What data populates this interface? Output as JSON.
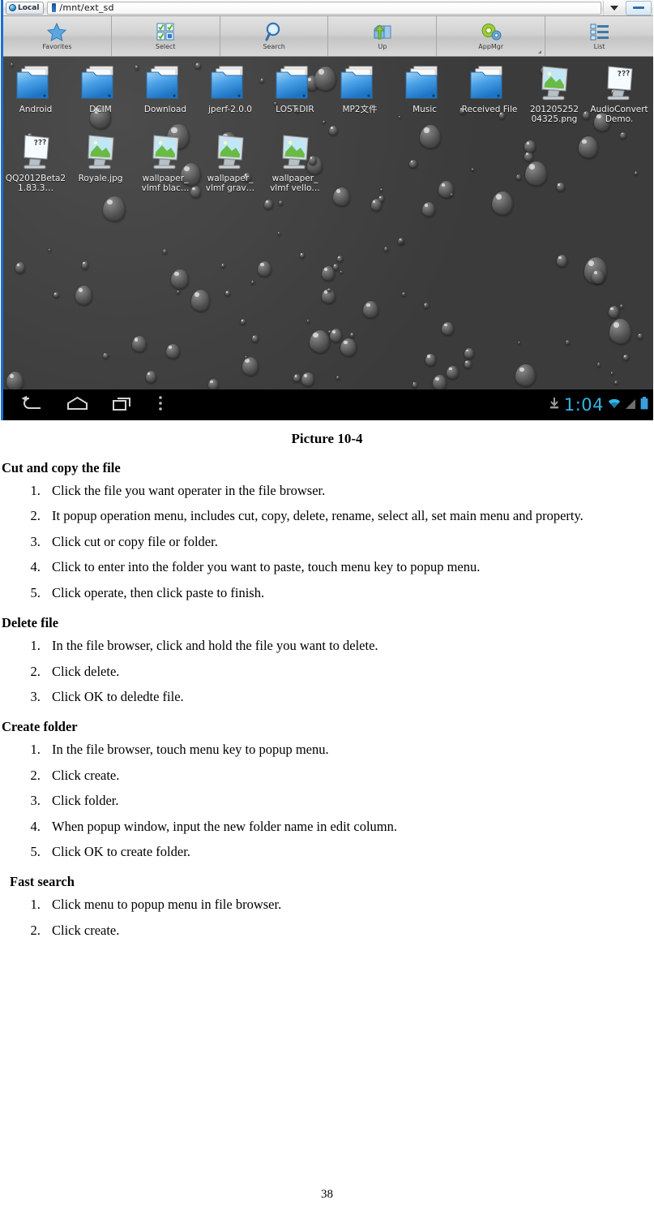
{
  "screenshot": {
    "titlebar": {
      "local_button": "Local",
      "path": "/mnt/ext_sd",
      "dropdown_icon": "chevron-down-icon",
      "minimize_icon": "minimize-icon"
    },
    "toolbar": [
      {
        "label": "Favorites",
        "icon": "star-icon"
      },
      {
        "label": "Select",
        "icon": "checkbox-grid-icon"
      },
      {
        "label": "Search",
        "icon": "magnifier-icon"
      },
      {
        "label": "Up",
        "icon": "folder-up-arrow-icon"
      },
      {
        "label": "AppMgr",
        "icon": "gears-icon"
      },
      {
        "label": "List",
        "icon": "list-view-icon"
      }
    ],
    "files": [
      {
        "name": "Android",
        "type": "folder"
      },
      {
        "name": "DCIM",
        "type": "folder"
      },
      {
        "name": "Download",
        "type": "folder"
      },
      {
        "name": "jperf-2.0.0",
        "type": "folder"
      },
      {
        "name": "LOST.DIR",
        "type": "folder"
      },
      {
        "name": "MP2文件",
        "type": "folder"
      },
      {
        "name": "Music",
        "type": "folder"
      },
      {
        "name": "Received File",
        "type": "folder"
      },
      {
        "name": "201205252 04325.png",
        "type": "image"
      },
      {
        "name": "AudioConvert Demo.",
        "type": "document"
      },
      {
        "name": "QQ2012Beta2 1.83.3…",
        "type": "document"
      },
      {
        "name": "Royale.jpg",
        "type": "image"
      },
      {
        "name": "wallpaper_ vlmf blac…",
        "type": "image"
      },
      {
        "name": "wallpaper_ vlmf grav…",
        "type": "image"
      },
      {
        "name": "wallpaper_ vlmf vello…",
        "type": "image"
      }
    ],
    "navbar": {
      "back": "back-icon",
      "home": "home-icon",
      "recents": "recent-apps-icon",
      "menu": "overflow-menu-icon",
      "download": "download-status-icon",
      "time": "1:04",
      "wifi": "wifi-icon",
      "signal": "signal-icon",
      "battery": "battery-icon"
    },
    "colors": {
      "accent_cyan": "#33b5e5",
      "desktop_bg": "#434343",
      "navbar_bg": "#000000",
      "window_border": "#1a6fd4"
    }
  },
  "caption": "Picture 10-4",
  "sections": [
    {
      "heading": "Cut and copy the file",
      "steps": [
        "Click the file you want operater in the file browser.",
        "It popup operation menu, includes cut, copy, delete, rename, select all, set main menu and property.",
        "Click cut or copy file or folder.",
        "Click to enter into the folder you want to paste, touch menu key to popup menu.",
        "Click operate, then click paste to finish."
      ]
    },
    {
      "heading": "Delete file",
      "steps": [
        "In the file browser, click and hold the file you want to delete.",
        "Click delete.",
        "Click OK to deledte file."
      ]
    },
    {
      "heading": "Create   folder",
      "steps": [
        "In the file browser, touch menu key to popup menu.",
        "Click create.",
        "Click folder.",
        "When popup window, input the new folder name in edit column.",
        "Click OK to create folder."
      ]
    },
    {
      "heading": "Fast search",
      "steps": [
        "Click menu to popup menu in file browser.",
        "Click create."
      ]
    }
  ],
  "page_number": "38"
}
